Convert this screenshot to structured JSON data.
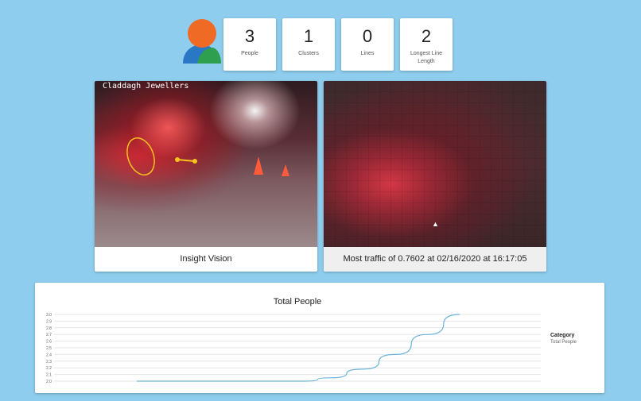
{
  "stats": [
    {
      "value": "3",
      "label": "People"
    },
    {
      "value": "1",
      "label": "Clusters"
    },
    {
      "value": "0",
      "label": "Lines"
    },
    {
      "value": "2",
      "label": "Longest Line Length"
    }
  ],
  "panels": {
    "camera": {
      "overlay_text": "Claddagh Jewellers",
      "caption": "Insight Vision"
    },
    "heatmap": {
      "caption": "Most traffic of 0.7602 at 02/16/2020 at 16:17:05"
    }
  },
  "colors": {
    "background": "#8ecdee",
    "line": "#6bb3d9",
    "logo_orange": "#ef6b25",
    "logo_blue": "#2a78c5",
    "logo_green": "#2e9e4f"
  },
  "chart_data": {
    "type": "line",
    "title": "Total People",
    "ylim": [
      2.0,
      3.0
    ],
    "yticks": [
      "3.0",
      "2.9",
      "2.8",
      "2.7",
      "2.6",
      "2.5",
      "2.4",
      "2.3",
      "2.2",
      "2.1",
      "2.0"
    ],
    "legend_title": "Category",
    "series": [
      {
        "name": "Total People",
        "x": [
          0,
          0.1,
          0.2,
          0.3,
          0.4,
          0.5,
          0.52,
          0.6,
          0.7,
          0.8,
          0.9,
          1.0
        ],
        "values": [
          2.0,
          2.0,
          2.0,
          2.0,
          2.0,
          2.0,
          2.0,
          2.05,
          2.18,
          2.4,
          2.7,
          3.0
        ]
      }
    ]
  }
}
